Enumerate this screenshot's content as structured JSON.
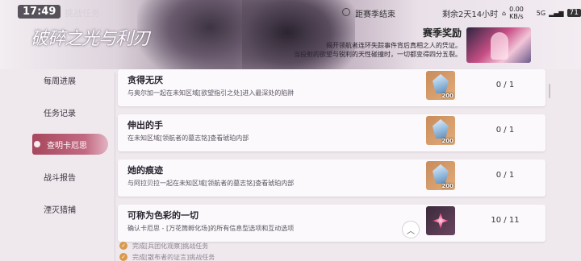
{
  "status_bar": {
    "time": "17:49",
    "page_title": "挑战任务",
    "season_end_label": "距赛季结束",
    "remaining": "剩余2天14小时",
    "network": "0.00 KB/s",
    "signal": "5G",
    "battery": "71"
  },
  "header": {
    "logo_text": "破碎之光与利刃",
    "season_title": "赛季奖励",
    "season_desc_line1": "揭开领航者连环失踪事件背后真相之人的凭证。",
    "season_desc_line2": "当投射的欲望与锐利的天性碰撞时，一切都变得四分五裂。"
  },
  "sidebar": {
    "items": [
      {
        "label": "每周进展",
        "active": false
      },
      {
        "label": "任务记录",
        "active": false
      },
      {
        "label": "查明卡厄思",
        "active": true
      },
      {
        "label": "战斗报告",
        "active": false
      },
      {
        "label": "湮灭猎捕",
        "active": false
      }
    ]
  },
  "quests": [
    {
      "title": "贪得无厌",
      "desc": "与奥尔加一起在未知区域[欲望指引之处]进入最深处的陷阱",
      "reward_qty": "200",
      "progress": "0 / 1"
    },
    {
      "title": "伸出的手",
      "desc": "在未知区域[领航者的墓志铭]查看琥珀内部",
      "reward_qty": "200",
      "progress": "0 / 1"
    },
    {
      "title": "她的痕迹",
      "desc": "与阿拉贝拉一起在未知区域[领航者的墓志铭]查看琥珀内部",
      "reward_qty": "200",
      "progress": "0 / 1"
    },
    {
      "title": "可称为色彩的一切",
      "desc": "确认卡厄思 - [万花筒孵化场]的所有信息型选项和互动选项",
      "reward_qty": "",
      "progress": "10 / 11"
    }
  ],
  "sub_tasks": [
    {
      "label": "完成[兵团化观察]挑战任务"
    },
    {
      "label": "完成[散布者的证言]挑战任务"
    }
  ],
  "colors": {
    "accent": "#b24f68",
    "check": "#d99a4a"
  }
}
